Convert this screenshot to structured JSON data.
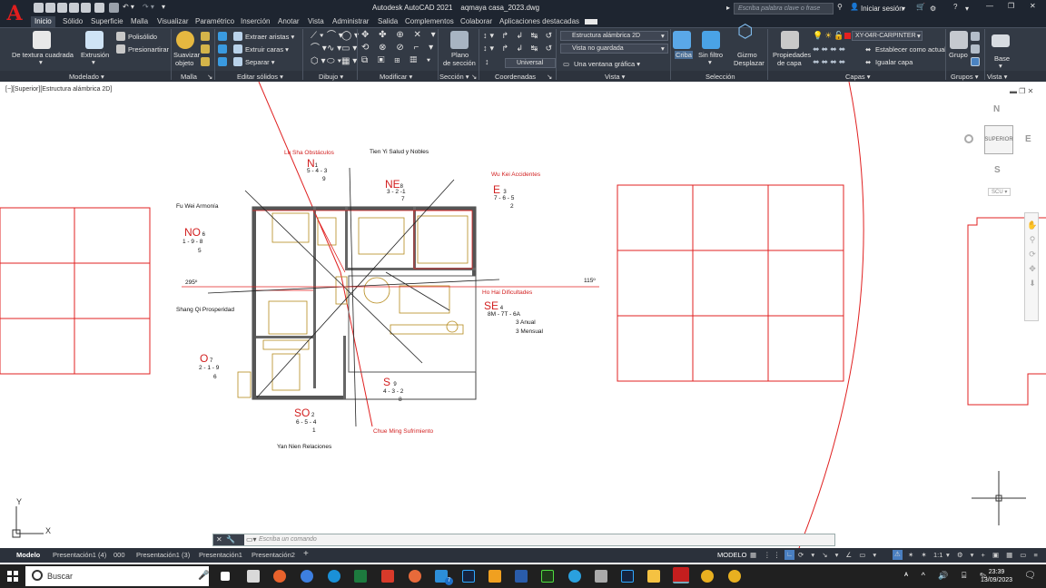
{
  "window": {
    "title": "Autodesk AutoCAD 2021",
    "file": "aqmaya casa_2023.dwg",
    "search_placeholder": "Escriba palabra clave o frase",
    "signin": "Iniciar sesión"
  },
  "menu_tabs": [
    "Inicio",
    "Sólido",
    "Superficie",
    "Malla",
    "Visualizar",
    "Paramétrico",
    "Inserción",
    "Anotar",
    "Vista",
    "Administrar",
    "Salida",
    "Complementos",
    "Colaborar",
    "Aplicaciones destacadas"
  ],
  "ribbon": {
    "modelado": {
      "de_textura": "De textura cuadrada",
      "extrusion": "Extrusión",
      "polisolido": "Polisólido",
      "presionartirar": "Presionartirar",
      "title": "Modelado"
    },
    "malla": {
      "suavizar": "Suavizar",
      "objeto": "objeto",
      "title": "Malla"
    },
    "editar": {
      "extraer_aristas": "Extraer aristas",
      "extruir_caras": "Extruir caras",
      "separar": "Separar",
      "title": "Editar sólidos"
    },
    "dibujo_title": "Dibujo",
    "modificar_title": "Modificar",
    "seccion": {
      "plano": "Plano",
      "de_seccion": "de sección",
      "title": "Sección"
    },
    "coordenadas": {
      "universal": "Universal",
      "title": "Coordenadas"
    },
    "vista": {
      "estilo": "Estructura alámbrica 2D",
      "no_guardada": "Vista no guardada",
      "ventana": "Una ventana gráfica",
      "title": "Vista"
    },
    "seleccion": {
      "criba": "Criba",
      "sin_filtro": "Sin filtro",
      "gizmo": "Gizmo",
      "desplazar": "Desplazar",
      "title": "Selección"
    },
    "capas": {
      "propiedades": "Propiedades",
      "de_capa": "de capa",
      "capa_actual": "XY-04R-CARPINTER",
      "establecer": "Establecer como actual",
      "igualar": "Igualar capa",
      "title": "Capas"
    },
    "grupos": {
      "grupo": "Grupo",
      "title": "Grupos"
    },
    "base": {
      "base": "Base",
      "title": "Vista"
    }
  },
  "viewport_label": "[−][Superior][Estructura alámbrica 2D]",
  "viewcube": {
    "face": "SUPERIOR",
    "n": "N",
    "s": "S",
    "e": "E",
    "o": "O",
    "scu": "SCU"
  },
  "drawing": {
    "north": {
      "name": "Lu Sha Obstáculos",
      "dir": "N",
      "num": "1",
      "stars": "5 - 4 - 3",
      "extra": "9"
    },
    "tien_yi": "Tien Yi Salud y Nobles",
    "ne": {
      "dir": "NE",
      "num": "8",
      "stars": "3 - 2 -1",
      "extra": "7"
    },
    "wu_kei": "Wu Kei Accidentes",
    "e": {
      "dir": "E",
      "num": "3",
      "stars": "7 - 6 - 5",
      "extra": "2"
    },
    "fu_wei": "Fu Wei Armonía",
    "no": {
      "dir": "NO",
      "num": "6",
      "stars": "1 - 9 - 8",
      "extra": "5"
    },
    "deg_left": "295º",
    "deg_right": "115º",
    "ho_hai": "Ho Hai Dificultades",
    "se": {
      "dir": "SE",
      "num": "4",
      "stars": "8M - 7T - 6A",
      "anual": "3 Anual",
      "mensual": "3 Mensual"
    },
    "shang_qi": "Shang Qi Prosperidad",
    "o": {
      "dir": "O",
      "num": "7",
      "stars": "2 - 1 - 9",
      "extra": "6"
    },
    "s": {
      "dir": "S",
      "num": "9",
      "stars": "4 - 3 - 2",
      "extra": "8"
    },
    "so": {
      "dir": "SO",
      "num": "2",
      "stars": "6 - 5 - 4",
      "extra": "1"
    },
    "chue_ming": "Chue Ming Sufrimiento",
    "yan_nien": "Yan Nien Relaciones",
    "axis_x": "X",
    "axis_y": "Y"
  },
  "command": {
    "placeholder": "Escriba un comando"
  },
  "layout_tabs": [
    "Modelo",
    "Presentación1 (4)",
    "000",
    "Presentación1 (3)",
    "Presentación1",
    "Presentación2"
  ],
  "status": {
    "modelo": "MODELO",
    "scale": "1:1"
  },
  "taskbar": {
    "search": "Buscar",
    "time": "23:39",
    "date": "13/09/2023",
    "badge": "7"
  }
}
